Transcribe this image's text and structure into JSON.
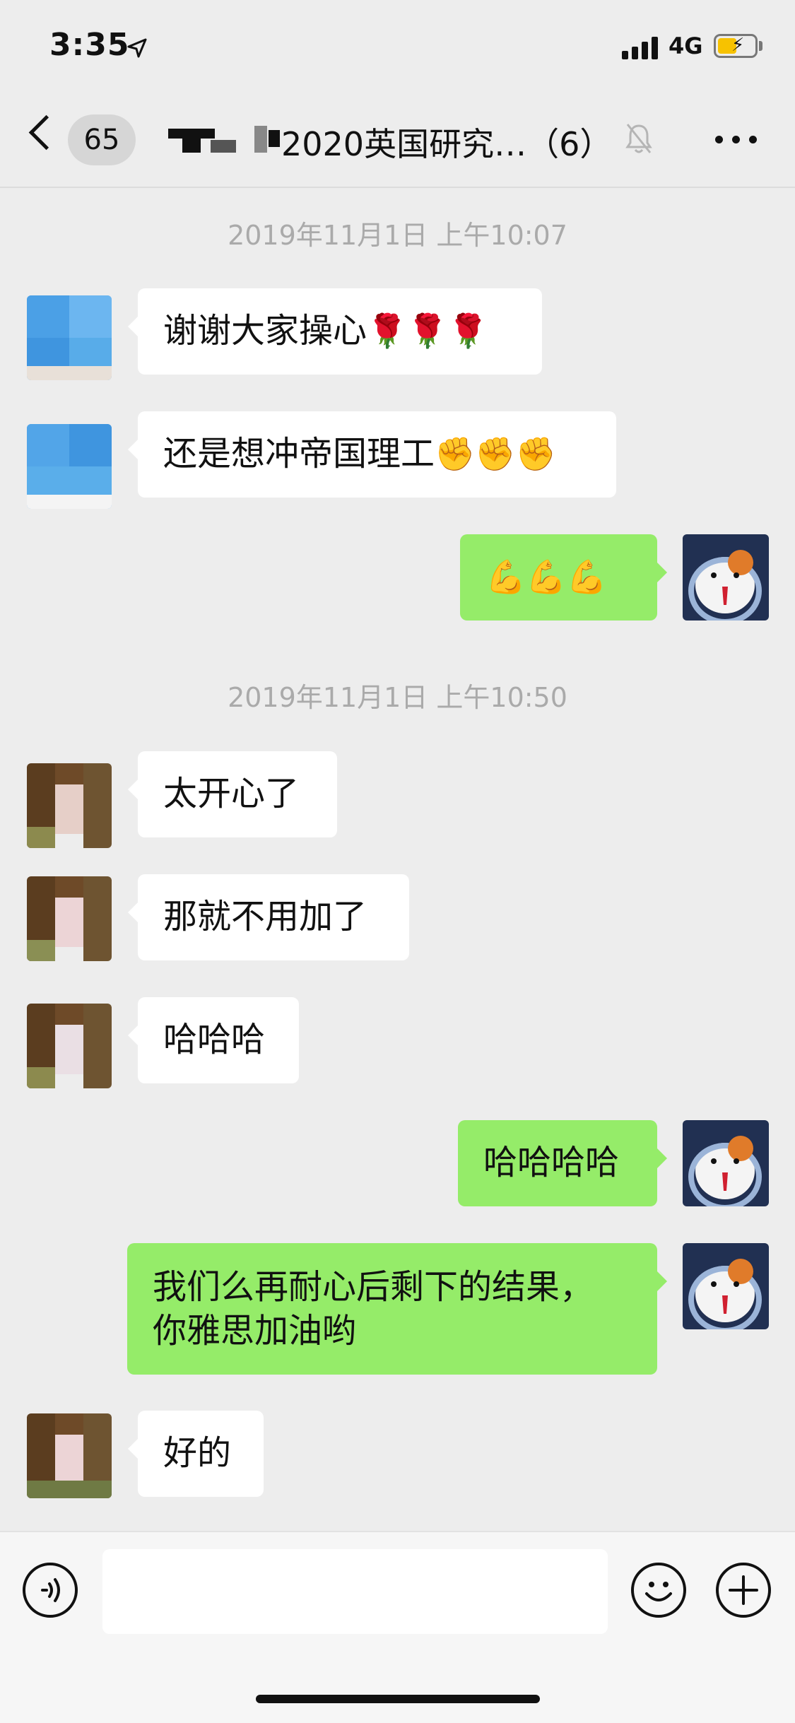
{
  "status": {
    "time": "3:35",
    "network": "4G",
    "battery_color": "#f7c200",
    "location_icon": "location-arrow-icon"
  },
  "nav": {
    "unread_count": "65",
    "title": "2020英国研究…（6）",
    "back_icon": "back-icon",
    "mute_icon": "bell-muted-icon",
    "more_icon": "more-icon"
  },
  "timestamps": [
    "2019年11月1日 上午10:07",
    "2019年11月1日 上午10:50"
  ],
  "messages": [
    {
      "side": "left",
      "text": "谢谢大家操心",
      "emoji": "🌹🌹🌹"
    },
    {
      "side": "left",
      "text": "还是想冲帝国理工",
      "emoji": "✊✊✊"
    },
    {
      "side": "right",
      "text": "",
      "emoji": "💪💪💪"
    },
    {
      "side": "left",
      "text": "太开心了"
    },
    {
      "side": "left",
      "text": "那就不用加了"
    },
    {
      "side": "left",
      "text": "哈哈哈"
    },
    {
      "side": "right",
      "text": "哈哈哈哈"
    },
    {
      "side": "right",
      "line1": "我们么再耐心后剩下的结果，",
      "line2": "你雅思加油哟"
    },
    {
      "side": "left",
      "text": "好的"
    }
  ],
  "colors": {
    "sent_bubble": "#95ec69",
    "received_bubble": "#ffffff",
    "background": "#ededed"
  },
  "input": {
    "voice_icon": "voice-icon",
    "emoji_icon": "emoji-face-icon",
    "plus_icon": "plus-icon"
  }
}
